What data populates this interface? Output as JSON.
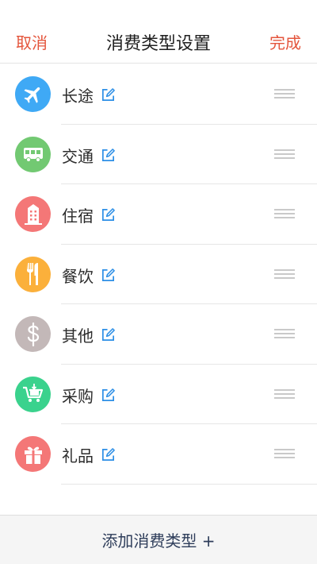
{
  "header": {
    "cancel_label": "取消",
    "title": "消费类型设置",
    "done_label": "完成"
  },
  "colors": {
    "accent": "#e4553c",
    "long_trip": "#3fa9f5",
    "transport": "#72c972",
    "lodging": "#f47777",
    "dining": "#fbb03b",
    "other": "#c3b8b8",
    "shopping": "#3ad28d",
    "gift": "#f47777",
    "edit_icon": "#2d8fe6"
  },
  "categories": [
    {
      "label": "长途",
      "icon": "airplane-icon"
    },
    {
      "label": "交通",
      "icon": "bus-icon"
    },
    {
      "label": "住宿",
      "icon": "hotel-icon"
    },
    {
      "label": "餐饮",
      "icon": "fork-knife-icon"
    },
    {
      "label": "其他",
      "icon": "dollar-icon"
    },
    {
      "label": "采购",
      "icon": "cart-icon"
    },
    {
      "label": "礼品",
      "icon": "gift-icon"
    }
  ],
  "footer": {
    "add_label": "添加消费类型 +"
  }
}
